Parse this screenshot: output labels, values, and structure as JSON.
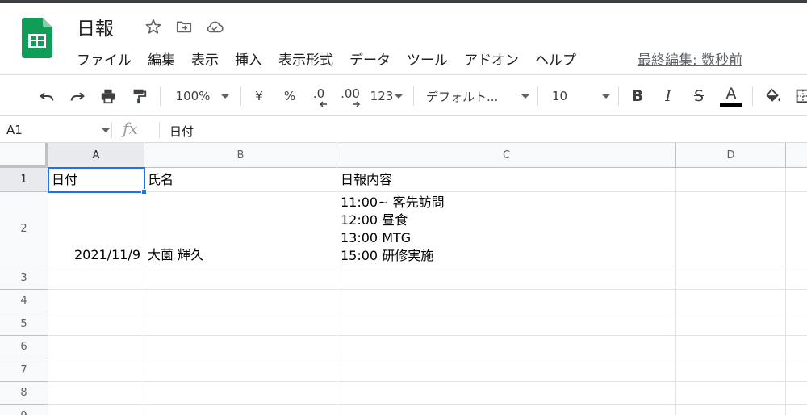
{
  "app": {
    "title": "日報",
    "last_edit": "最終編集: 数秒前"
  },
  "icons": {
    "logo": "google-sheets-logo",
    "star": "star-icon",
    "move": "folder-move-icon",
    "cloud": "cloud-saved-icon"
  },
  "menu": [
    "ファイル",
    "編集",
    "表示",
    "挿入",
    "表示形式",
    "データ",
    "ツール",
    "アドオン",
    "ヘルプ"
  ],
  "toolbar": {
    "zoom": "100%",
    "currency": "¥",
    "percent": "%",
    "dec_decrease": ".0",
    "dec_increase": ".00",
    "number_format": "123",
    "font": "デフォルト...",
    "font_size": "10",
    "bold": "B",
    "italic": "I",
    "strike": "S",
    "text_color": "A",
    "text_color_value": "#000000"
  },
  "formula_bar": {
    "cell_ref": "A1",
    "fx": "fx",
    "value": "日付"
  },
  "columns": [
    "A",
    "B",
    "C",
    "D"
  ],
  "rows": [
    "1",
    "2",
    "3",
    "4",
    "5",
    "6",
    "7",
    "8",
    "9"
  ],
  "cells": {
    "A1": "日付",
    "B1": "氏名",
    "C1": "日報内容",
    "A2": "2021/11/9",
    "B2": "大薗 輝久",
    "C2": "11:00~ 客先訪問\n12:00 昼食\n13:00 MTG\n15:00 研修実施"
  },
  "colors": {
    "selection": "#1a73e8",
    "sheets_green": "#0f9d58"
  }
}
